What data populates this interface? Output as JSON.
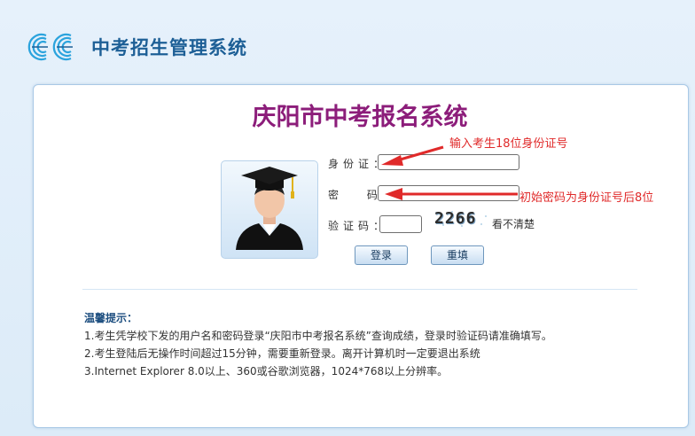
{
  "app": {
    "title": "中考招生管理系统"
  },
  "login": {
    "title": "庆阳市中考报名系统",
    "id_label": "身份证：",
    "password_label": "密 码：",
    "captcha_label": "验证码：",
    "id_value": "",
    "password_value": "",
    "captcha_value": "",
    "captcha_text": "2266",
    "refresh_label": "看不清楚",
    "login_button": "登录",
    "reset_button": "重填"
  },
  "annotations": {
    "id_hint": "输入考生18位身份证号",
    "password_hint": "初始密码为身份证号后8位"
  },
  "tips": {
    "heading": "温馨提示：",
    "items": [
      "1.考生凭学校下发的用户名和密码登录“庆阳市中考报名系统”查询成绩，登录时验证码请准确填写。",
      "2.考生登陆后无操作时间超过15分钟，需要重新登录。离开计算机时一定要退出系统",
      "3.Internet Explorer 8.0以上、360或谷歌浏览器，1024*768以上分辨率。"
    ]
  },
  "colors": {
    "brand_blue": "#1d5f96",
    "title_purple": "#8c1d7a",
    "annotation_red": "#e02a2a",
    "logo_cyan": "#2ba3dd"
  },
  "icons": {
    "logo": "cc-logo-icon",
    "avatar": "graduate-avatar-icon",
    "arrow": "red-arrow-icon"
  }
}
